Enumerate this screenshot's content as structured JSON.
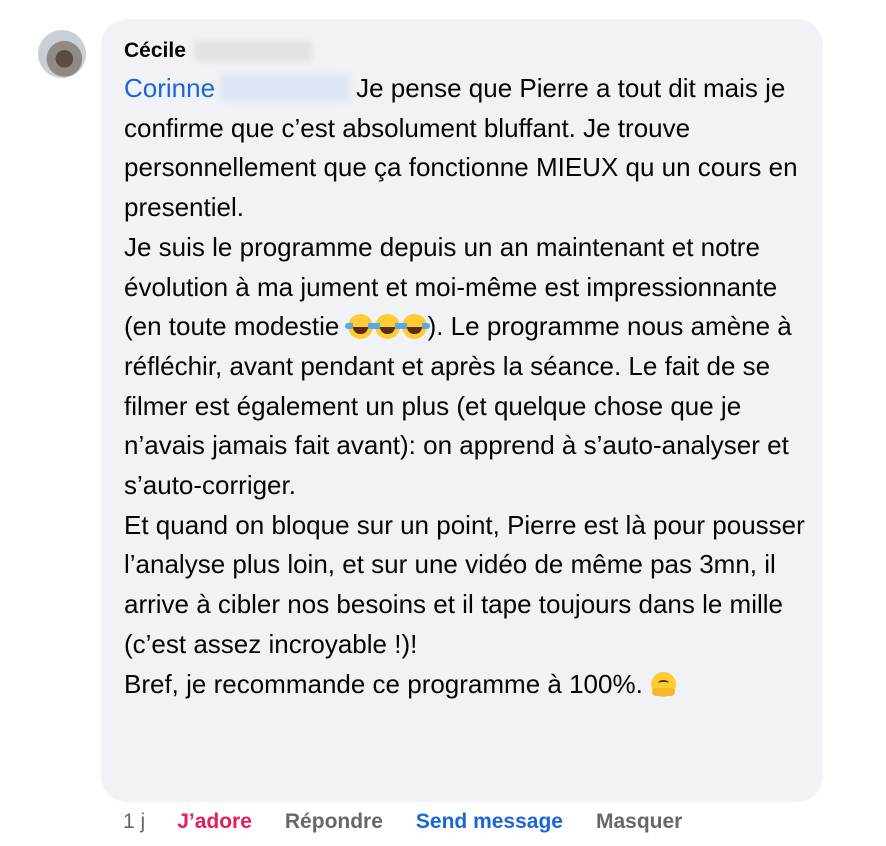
{
  "comment": {
    "author": "Cécile",
    "mention": "Corinne",
    "line1_rest": "Je pense que Pierre a tout dit mais je confirme que c’est absolument bluffant.",
    "line2": "Je trouve personnellement que ça fonctionne MIEUX qu un cours en presentiel.",
    "para2_a": "Je suis le programme depuis un an maintenant et notre évolution à ma jument et moi-même est impressionnante (en toute modestie ",
    "para2_b": "). Le programme nous amène à réfléchir, avant pendant et après la séance. Le fait de se filmer est également un plus (et quelque chose que je n’avais jamais fait avant): on apprend à s’auto-analyser et s’auto-corriger.",
    "para3": "Et quand on bloque sur un point, Pierre est là pour pousser l’analyse plus loin, et sur une vidéo de même pas 3mn, il arrive à cibler nos besoins et il tape toujours dans le mille (c’est assez incroyable !)!",
    "para4": "Bref, je recommande ce programme à 100%. ",
    "emojis": [
      "face-with-tears-of-joy",
      "face-with-tears-of-joy",
      "face-with-tears-of-joy",
      "hugging-face"
    ]
  },
  "actions": {
    "time": "1 j",
    "reaction": "J’adore",
    "reply": "Répondre",
    "send_message": "Send message",
    "hide": "Masquer"
  },
  "colors": {
    "bubble": "#f0f2f5",
    "link": "#1a66d6",
    "reaction": "#e41e5d",
    "meta": "#65676b"
  }
}
